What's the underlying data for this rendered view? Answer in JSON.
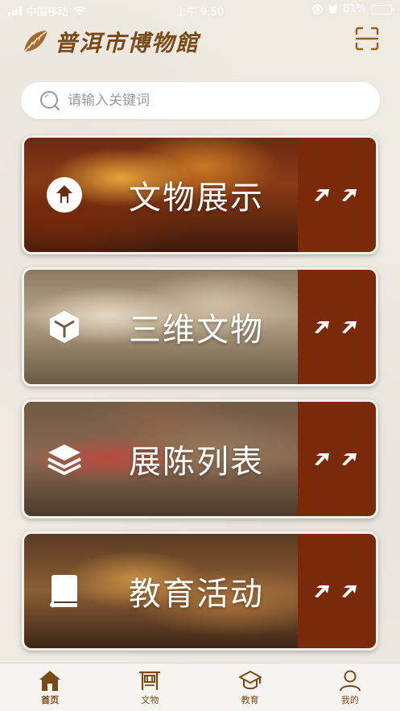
{
  "status_bar": {
    "carrier": "中国移动",
    "time": "上午 9:50",
    "battery": "81%"
  },
  "header": {
    "title": "普洱市博物館"
  },
  "search": {
    "placeholder": "请输入关键词"
  },
  "cards": [
    {
      "title": "文物展示",
      "icon": "artifact-icon"
    },
    {
      "title": "三维文物",
      "icon": "cube-icon"
    },
    {
      "title": "展陈列表",
      "icon": "layers-icon"
    },
    {
      "title": "教育活动",
      "icon": "book-icon"
    }
  ],
  "tabbar": {
    "items": [
      {
        "label": "首页",
        "icon": "home-icon",
        "active": true
      },
      {
        "label": "文物",
        "icon": "artifact-tab-icon",
        "active": false
      },
      {
        "label": "教育",
        "icon": "graduation-cap-icon",
        "active": false
      },
      {
        "label": "我的",
        "icon": "user-icon",
        "active": false
      }
    ]
  },
  "colors": {
    "accent": "#7a2a08",
    "brand_text": "#7a4a16",
    "background": "#eeeae2"
  }
}
